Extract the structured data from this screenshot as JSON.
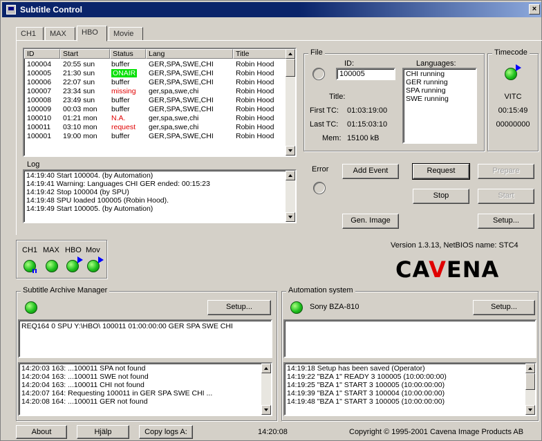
{
  "window": {
    "title": "Subtitle Control",
    "close_glyph": "×"
  },
  "tabs": [
    {
      "label": "CH1"
    },
    {
      "label": "MAX"
    },
    {
      "label": "HBO"
    },
    {
      "label": "Movie"
    }
  ],
  "active_tab": "HBO",
  "jobs": {
    "columns": [
      "ID",
      "Start",
      "Status",
      "Lang",
      "Title"
    ],
    "rows": [
      {
        "id": "100004",
        "start": "20:55 sun",
        "status": "buffer",
        "lang": "GER,SPA,SWE,CHI",
        "title": "Robin Hood"
      },
      {
        "id": "100005",
        "start": "21:30 sun",
        "status": "ONAIR",
        "lang": "GER,SPA,SWE,CHI",
        "title": "Robin Hood"
      },
      {
        "id": "100006",
        "start": "22:07 sun",
        "status": "buffer",
        "lang": "GER,SPA,SWE,CHI",
        "title": "Robin Hood"
      },
      {
        "id": "100007",
        "start": "23:34 sun",
        "status": "missing",
        "lang": "ger,spa,swe,chi",
        "title": "Robin Hood"
      },
      {
        "id": "100008",
        "start": "23:49 sun",
        "status": "buffer",
        "lang": "GER,SPA,SWE,CHI",
        "title": "Robin Hood"
      },
      {
        "id": "100009",
        "start": "00:03 mon",
        "status": "buffer",
        "lang": "GER,SPA,SWE,CHI",
        "title": "Robin Hood"
      },
      {
        "id": "100010",
        "start": "01:21 mon",
        "status": "N.A.",
        "lang": "ger,spa,swe,chi",
        "title": "Robin Hood"
      },
      {
        "id": "100011",
        "start": "03:10 mon",
        "status": "request",
        "lang": "ger,spa,swe,chi",
        "title": "Robin Hood"
      },
      {
        "id": "100001",
        "start": "19:00 mon",
        "status": "buffer",
        "lang": "GER,SPA,SWE,CHI",
        "title": "Robin Hood"
      }
    ]
  },
  "log": {
    "label": "Log",
    "lines": [
      "14:19:40  Start 100004. (by Automation)",
      "14:19:41  Warning: Languages CHI GER ended: 00:15:23",
      "14:19:42  Stop 100004 (by SPU)",
      "14:19:48  SPU loaded 100005 (Robin Hood).",
      "14:19:49  Start 100005. (by Automation)"
    ]
  },
  "file": {
    "group_label": "File",
    "id_label": "ID:",
    "id_value": "100005",
    "languages_label": "Languages:",
    "languages": [
      "CHI   running",
      "GER   running",
      "SPA   running",
      "SWE   running"
    ],
    "title_label": "Title:",
    "first_tc_label": "First TC:",
    "first_tc": "01:03:19:00",
    "last_tc_label": "Last TC:",
    "last_tc": "01:15:03:10",
    "mem_label": "Mem:",
    "mem": "15100 kB"
  },
  "timecode": {
    "group_label": "Timecode",
    "source": "VITC",
    "time": "00:15:49",
    "userbits": "00000000"
  },
  "error_label": "Error",
  "buttons": {
    "add_event": "Add Event",
    "request": "Request",
    "prepare": "Prepare",
    "stop": "Stop",
    "start": "Start",
    "gen_image": "Gen. Image",
    "setup": "Setup..."
  },
  "channels": {
    "labels": [
      "CH1",
      "MAX",
      "HBO",
      "Mov"
    ]
  },
  "version_text": "Version 1.3.13,  NetBIOS name: STC4",
  "brand": {
    "pre": "CA",
    "mid": "V",
    "post": "ENA"
  },
  "archive": {
    "group_label": "Subtitle Archive Manager",
    "setup": "Setup...",
    "request_line": "REQ164 0 SPU Y:\\HBO\\ 100011 01:00:00:00 GER SPA SWE CHI",
    "log": [
      "14:20:03  163: ...100011 SPA not found",
      "14:20:04  163: ...100011 SWE not found",
      "14:20:04  163: ...100011 CHI not found",
      "14:20:07  164: Requesting 100011 in GER SPA SWE CHI ...",
      "14:20:08  164: ...100011 GER not found"
    ]
  },
  "automation": {
    "group_label": "Automation system",
    "device": "Sony BZA-810",
    "setup": "Setup...",
    "log": [
      "14:19:18  Setup has been saved (Operator)",
      "14:19:22  \"BZA 1\" READY 3 100005 (10:00:00:00)",
      "14:19:25  \"BZA 1\" START 3 100005 (10:00:00:00)",
      "14:19:39  \"BZA 1\" START 3 100004 (10:00:00:00)",
      "14:19:48  \"BZA 1\" START 3 100005 (10:00:00:00)"
    ]
  },
  "footer": {
    "about": "About",
    "help": "Hjälp",
    "copy_logs": "Copy logs A:",
    "clock": "14:20:08",
    "copyright": "Copyright © 1995-2001 Cavena Image Products AB"
  }
}
